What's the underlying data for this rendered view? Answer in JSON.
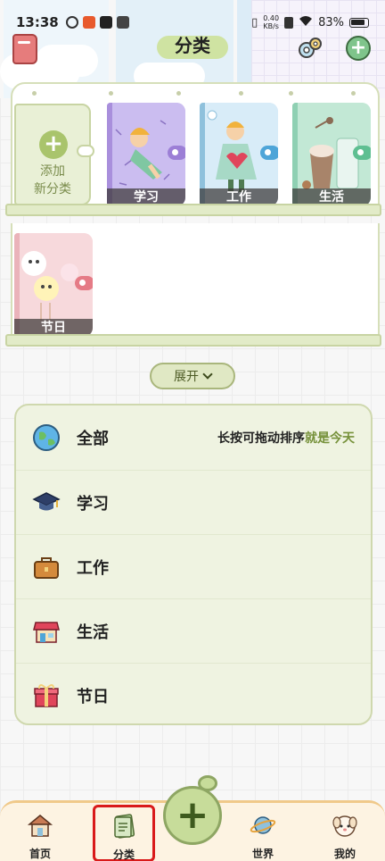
{
  "status_bar": {
    "time": "13:38",
    "net_speed_value": "0.40",
    "net_speed_unit": "KB/s",
    "battery": "83%"
  },
  "header": {
    "title": "分类"
  },
  "shelf": {
    "add_label_line1": "添加",
    "add_label_line2": "新分类",
    "notebooks": [
      {
        "label": "学习",
        "cover_color": "#c9b8ec",
        "clasp_color": "#9c7fd6"
      },
      {
        "label": "工作",
        "cover_color": "#d5eaf6",
        "clasp_color": "#4ea5d8"
      },
      {
        "label": "生活",
        "cover_color": "#bde6d1",
        "clasp_color": "#5fbf92"
      },
      {
        "label": "节日",
        "cover_color": "#f6d6d9",
        "clasp_color": "#e57b86"
      }
    ]
  },
  "expand_button": {
    "label": "展开"
  },
  "category_list": {
    "hint_prefix": "长按可拖动排序",
    "hint_accent": "就是今天",
    "items": [
      {
        "name": "全部",
        "icon": "globe-icon"
      },
      {
        "name": "学习",
        "icon": "graduation-cap-icon"
      },
      {
        "name": "工作",
        "icon": "briefcase-icon"
      },
      {
        "name": "生活",
        "icon": "shop-icon"
      },
      {
        "name": "节日",
        "icon": "gift-icon"
      }
    ]
  },
  "bottom_nav": {
    "items": [
      {
        "label": "首页",
        "icon": "home-icon"
      },
      {
        "label": "分类",
        "icon": "category-icon"
      },
      {
        "label": "世界",
        "icon": "planet-icon"
      },
      {
        "label": "我的",
        "icon": "profile-avatar-icon"
      }
    ]
  },
  "colors": {
    "accent_green": "#76913a",
    "nav_active_outline": "#d91a1a",
    "fab_green": "#c7dc9a"
  }
}
